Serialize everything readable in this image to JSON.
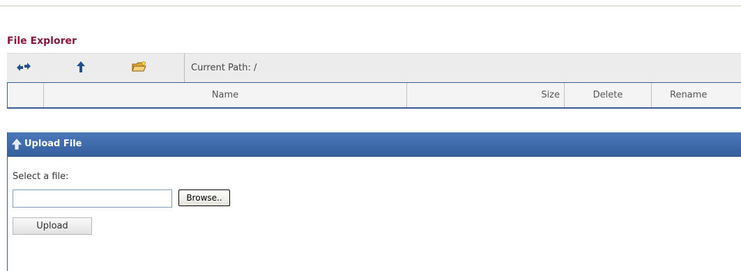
{
  "file_explorer": {
    "title": "File Explorer",
    "toolbar": {
      "buttons": [
        {
          "name": "refresh-arrows-icon"
        },
        {
          "name": "up-arrow-icon"
        },
        {
          "name": "new-folder-icon"
        }
      ],
      "path_label": "Current Path: /"
    },
    "grid": {
      "columns": [
        "",
        "Name",
        "Size",
        "Delete",
        "Rename"
      ]
    }
  },
  "upload": {
    "header": "Upload File",
    "select_label": "Select a file:",
    "file_value": "",
    "browse_label": "Browse..",
    "upload_label": "Upload"
  },
  "colors": {
    "title": "#8b1538",
    "panel_header": "#4b78b9",
    "border": "#3a5c96",
    "icon_blue": "#1f4f93",
    "folder_yellow": "#f2c94c"
  }
}
